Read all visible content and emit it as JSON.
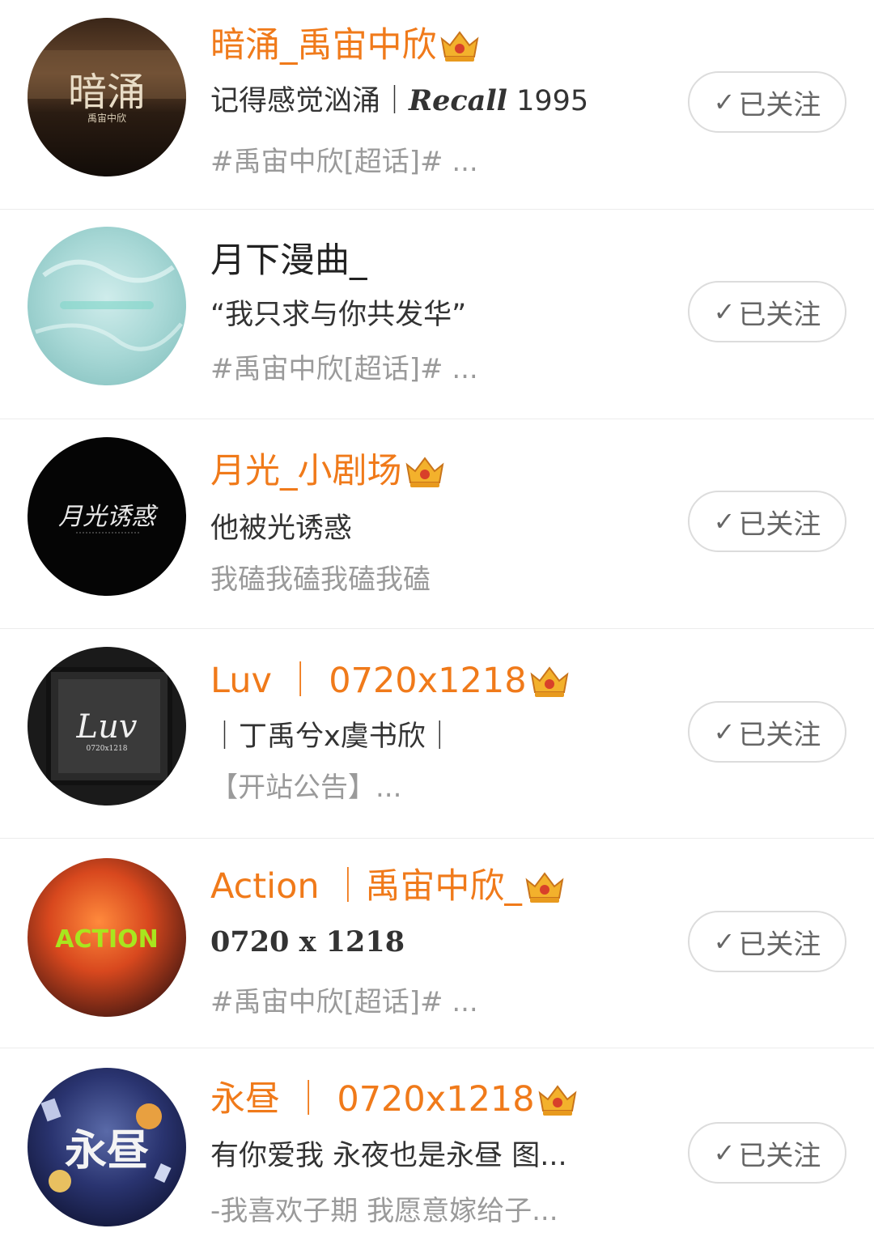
{
  "users": [
    {
      "name": "暗涌_禹宙中欣",
      "vip": true,
      "bio_text": "记得感觉汹涌｜",
      "bio_text2": "Recall",
      "bio_text3": " 1995",
      "desc": "#禹宙中欣[超话]#  ...",
      "button": "已关注",
      "avatar_text": "暗涌",
      "avatar_sub": "禹宙中欣"
    },
    {
      "name": "月下漫曲_",
      "vip": false,
      "bio_text": "“我只求与你共发华”",
      "desc": "#禹宙中欣[超话]# ...",
      "button": "已关注"
    },
    {
      "name": "月光_小剧场",
      "vip": true,
      "bio_text": "他被光诱惑",
      "desc": "我磕我磕我磕我磕",
      "button": "已关注",
      "avatar_text": "月光诱惑"
    },
    {
      "name": "Luv ｜ 0720x1218",
      "vip": true,
      "bio_text": "｜丁禹兮x虞书欣｜",
      "desc": "【开站公告】...",
      "button": "已关注",
      "avatar_text": "Luv",
      "avatar_sub": "0720x1218"
    },
    {
      "name": "Action ｜禹宙中欣_",
      "vip": true,
      "bio_text": "0720 x 1218",
      "desc": "#禹宙中欣[超话]#  ...",
      "button": "已关注",
      "avatar_text": "ACTION"
    },
    {
      "name": "永昼 ｜ 0720x1218",
      "vip": true,
      "bio_text": "有你爱我 永夜也是永昼 图...",
      "desc": "-我喜欢子期 我愿意嫁给子...",
      "button": "已关注",
      "avatar_text": "永昼"
    }
  ],
  "colors": {
    "vip_name": "#f07a1a",
    "crown": "#f0a020"
  },
  "icons": {
    "crown": "crown-icon",
    "check": "check-icon"
  }
}
